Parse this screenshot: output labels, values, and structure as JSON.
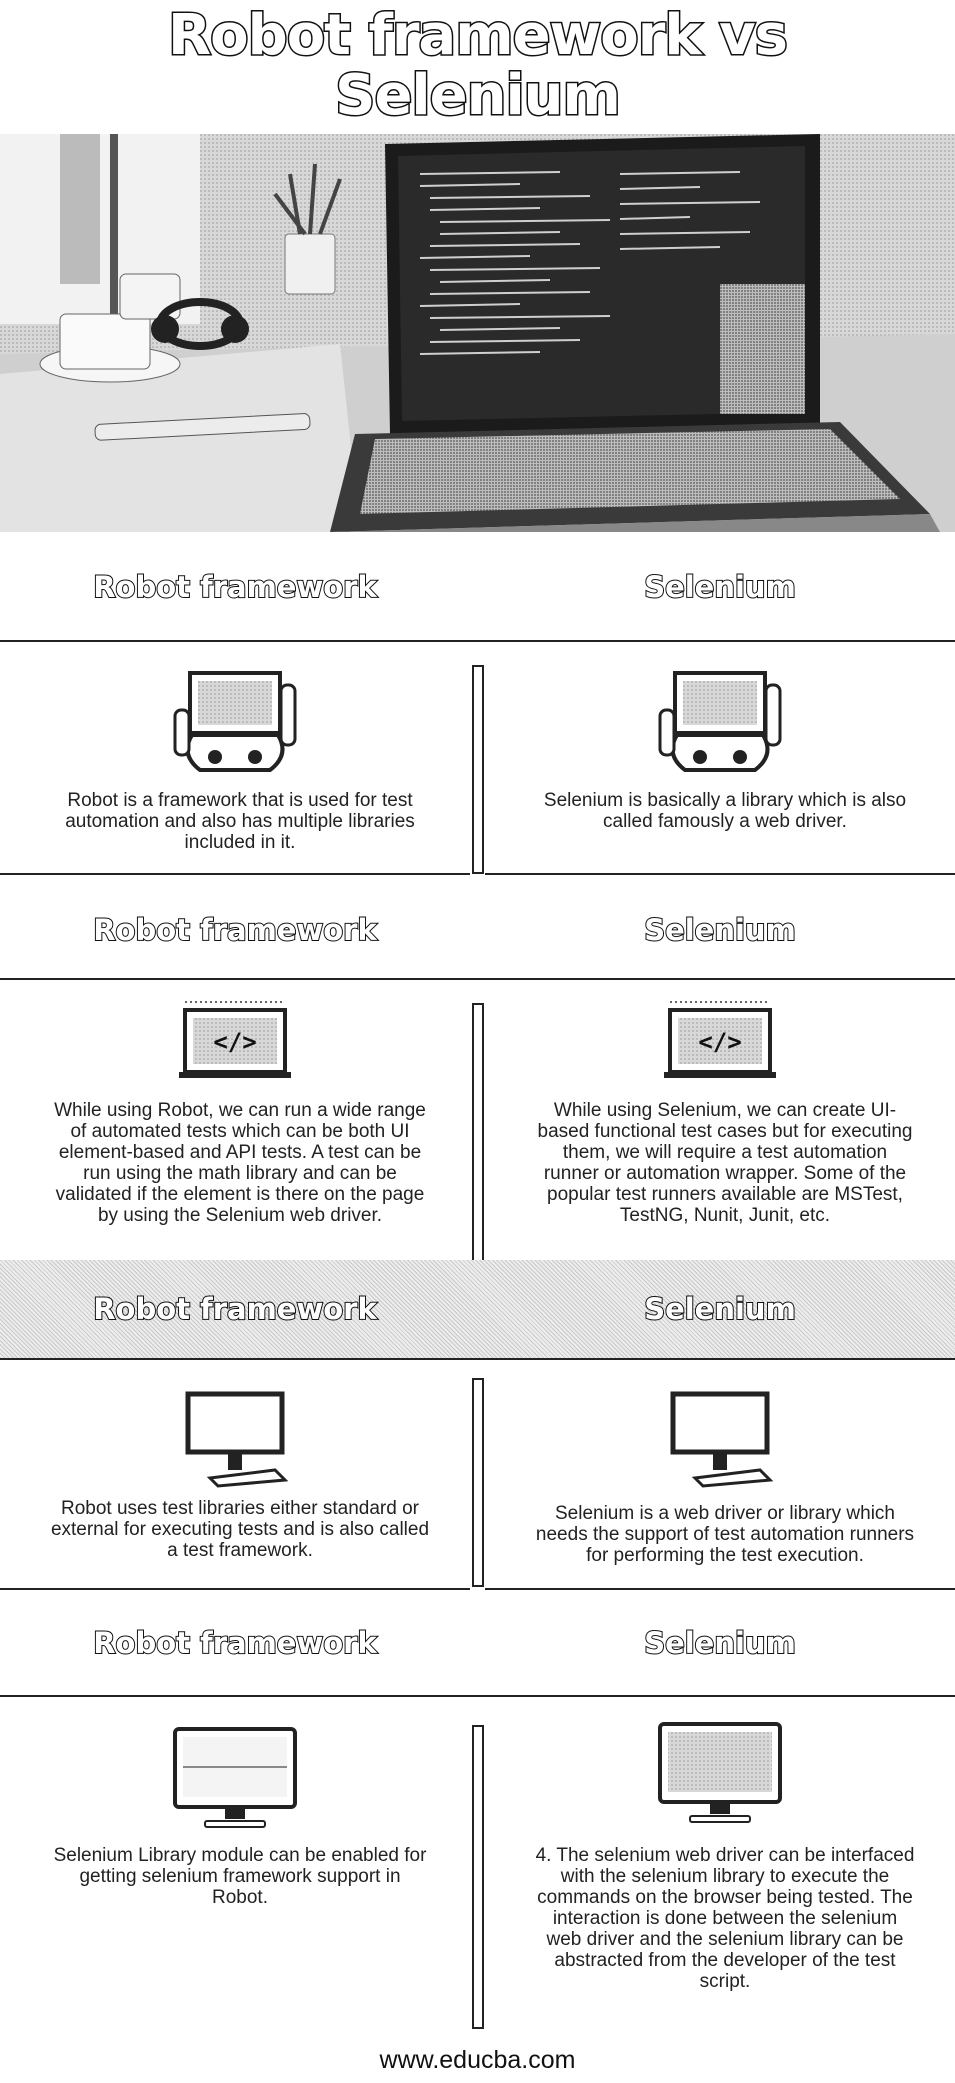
{
  "title": {
    "line1": "Robot framework vs",
    "line2": "Selenium"
  },
  "sections": [
    {
      "left_heading": "Robot framework",
      "right_heading": "Selenium",
      "left_text": "Robot is a framework that is used for test automation and also has multiple libraries included in it.",
      "right_text": "Selenium is basically a library which is also called famously a web driver."
    },
    {
      "left_heading": "Robot framework",
      "right_heading": "Selenium",
      "left_text": "While using Robot, we can run a wide range of automated tests which can be both UI element-based and API tests. A test can be run using the math library and can be validated if the element is there on the page by using the Selenium web driver.",
      "right_text": "While using Selenium, we can create UI-based functional test cases but for executing them, we will require a test automation runner or automation wrapper. Some of the popular test runners available are MSTest, TestNG, Nunit, Junit, etc."
    },
    {
      "left_heading": "Robot framework",
      "right_heading": "Selenium",
      "left_text": "Robot uses test libraries either standard or external for executing tests and is also called a test framework.",
      "right_text": "Selenium is a web driver or library which needs the support of test automation runners for performing the test execution."
    },
    {
      "left_heading": "Robot framework",
      "right_heading": "Selenium",
      "left_text": "Selenium Library module can be enabled for getting selenium framework support in Robot.",
      "right_text": "4. The selenium web driver can be interfaced with the selenium library to execute the commands on the browser being tested. The interaction is done between the selenium web driver and the selenium library can be abstracted from the developer of the test script."
    }
  ],
  "icons": {
    "section1": "robot-laptop-icon",
    "section2": "code-monitor-icon",
    "section3": "desktop-computer-icon",
    "section4": "imac-monitor-icon"
  },
  "footer": "www.educba.com"
}
